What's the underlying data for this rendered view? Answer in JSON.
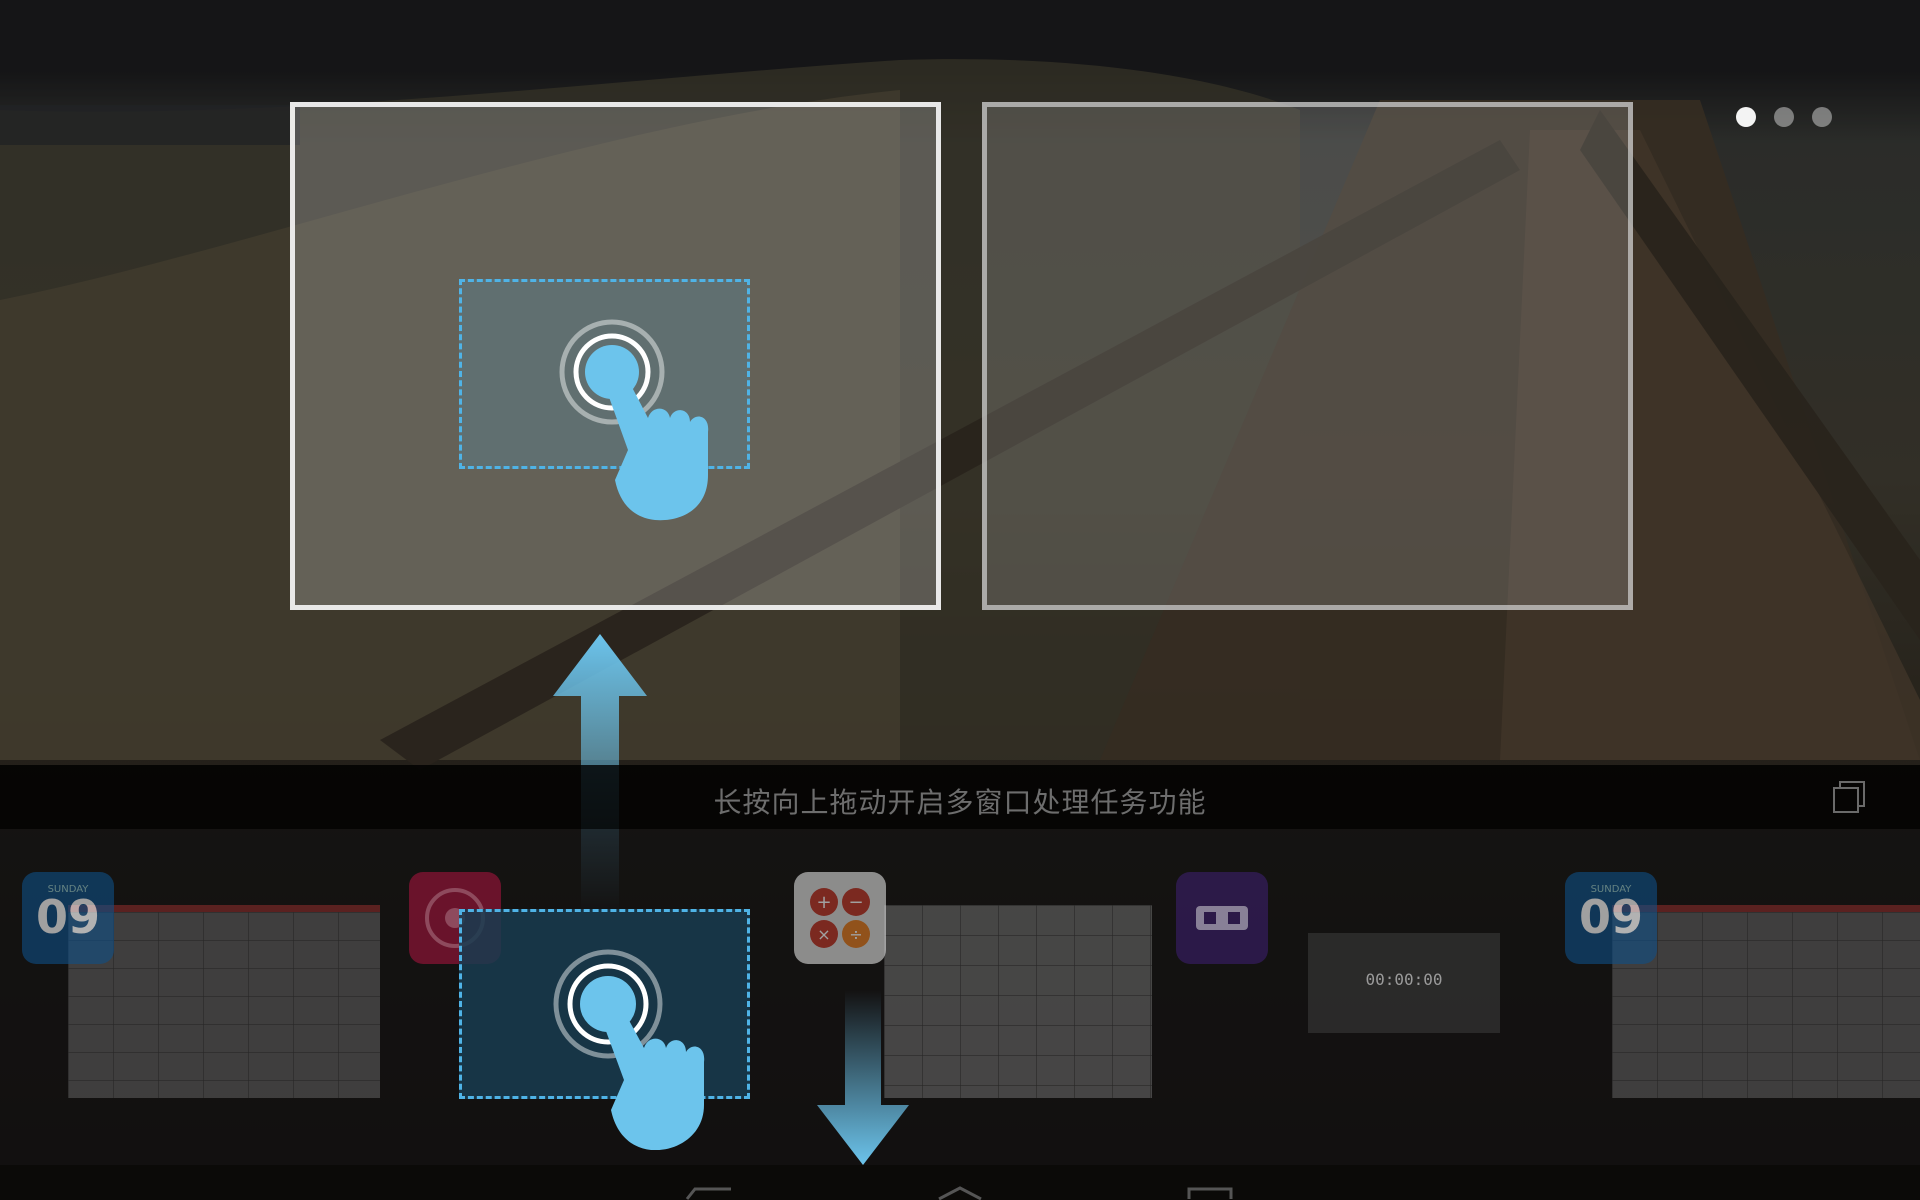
{
  "wallpaper": {
    "description_icon": "boardwalk-wallpaper"
  },
  "page_indicator": {
    "count": 3,
    "active_index": 0
  },
  "instruction": {
    "text": "长按向上拖动开启多窗口处理任务功能",
    "multiwindow_icon": "multi-window-icon"
  },
  "recents": {
    "apps": [
      {
        "name": "calendar",
        "icon": "calendar-icon",
        "day_label": "SUNDAY",
        "day_number": "09"
      },
      {
        "name": "gallery",
        "icon": "gallery-icon"
      },
      {
        "name": "calculator",
        "icon": "calculator-icon"
      },
      {
        "name": "clock",
        "icon": "clock-icon",
        "stopwatch": "00:00:00"
      },
      {
        "name": "calendar",
        "icon": "calendar-icon",
        "day_label": "SUNDAY",
        "day_number": "09"
      }
    ]
  },
  "colors": {
    "accent": "#4fb3e6",
    "hand": "#6cc4ec"
  },
  "navbar": {
    "buttons": [
      "back-icon",
      "home-icon",
      "recents-icon"
    ]
  }
}
